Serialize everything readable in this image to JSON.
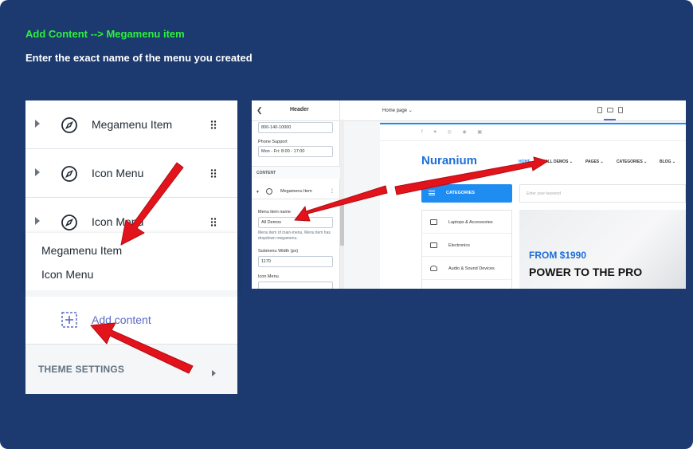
{
  "instructions": {
    "heading": "Add Content --> Megamenu item",
    "subheading": "Enter the exact name of the menu you created"
  },
  "colors": {
    "background": "#1c3a70",
    "heading": "#2cf13a",
    "accent": "#5c6ac4",
    "arrow": "#e3131b"
  },
  "editor": {
    "rows": [
      {
        "label": "Megamenu Item",
        "icon": "compass-icon"
      },
      {
        "label": "Icon Menu",
        "icon": "compass-icon"
      },
      {
        "label": "Icon Menu",
        "icon": "compass-icon"
      }
    ],
    "dropdown": [
      "Megamenu Item",
      "Icon Menu"
    ],
    "add_content": "Add content",
    "theme_settings": "THEME SETTINGS"
  },
  "screenshot": {
    "sidebar": {
      "title": "Header",
      "phone_value": "800-140-10000",
      "phone_support_label": "Phone Support",
      "hours_value": "Mon - Fri: 8:00 - 17:00",
      "content_label": "CONTENT",
      "item_label": "Megamenu Item",
      "menu_name_label": "Menu item name",
      "menu_name_value": "All Demos",
      "help_text": "Menu item of main-menu. Menu item has dropdown megamenu.",
      "submenu_width_label": "Submenu Width (px)",
      "submenu_width_value": "1170",
      "icon_menu_label": "Icon Menu"
    },
    "topbar": {
      "page_select": "Home page"
    },
    "site": {
      "logo": "Nuranium",
      "nav": [
        "HOME",
        "ALL DEMOS",
        "PAGES",
        "CATEGORIES",
        "BLOG"
      ],
      "categories_button": "CATEGORIES",
      "search_placeholder": "Enter your keyword",
      "category_list": [
        "Laptops & Accessories",
        "Electronics",
        "Audio & Sound Devices"
      ],
      "banner_from": "FROM $1990",
      "banner_title": "POWER TO THE PRO"
    }
  }
}
